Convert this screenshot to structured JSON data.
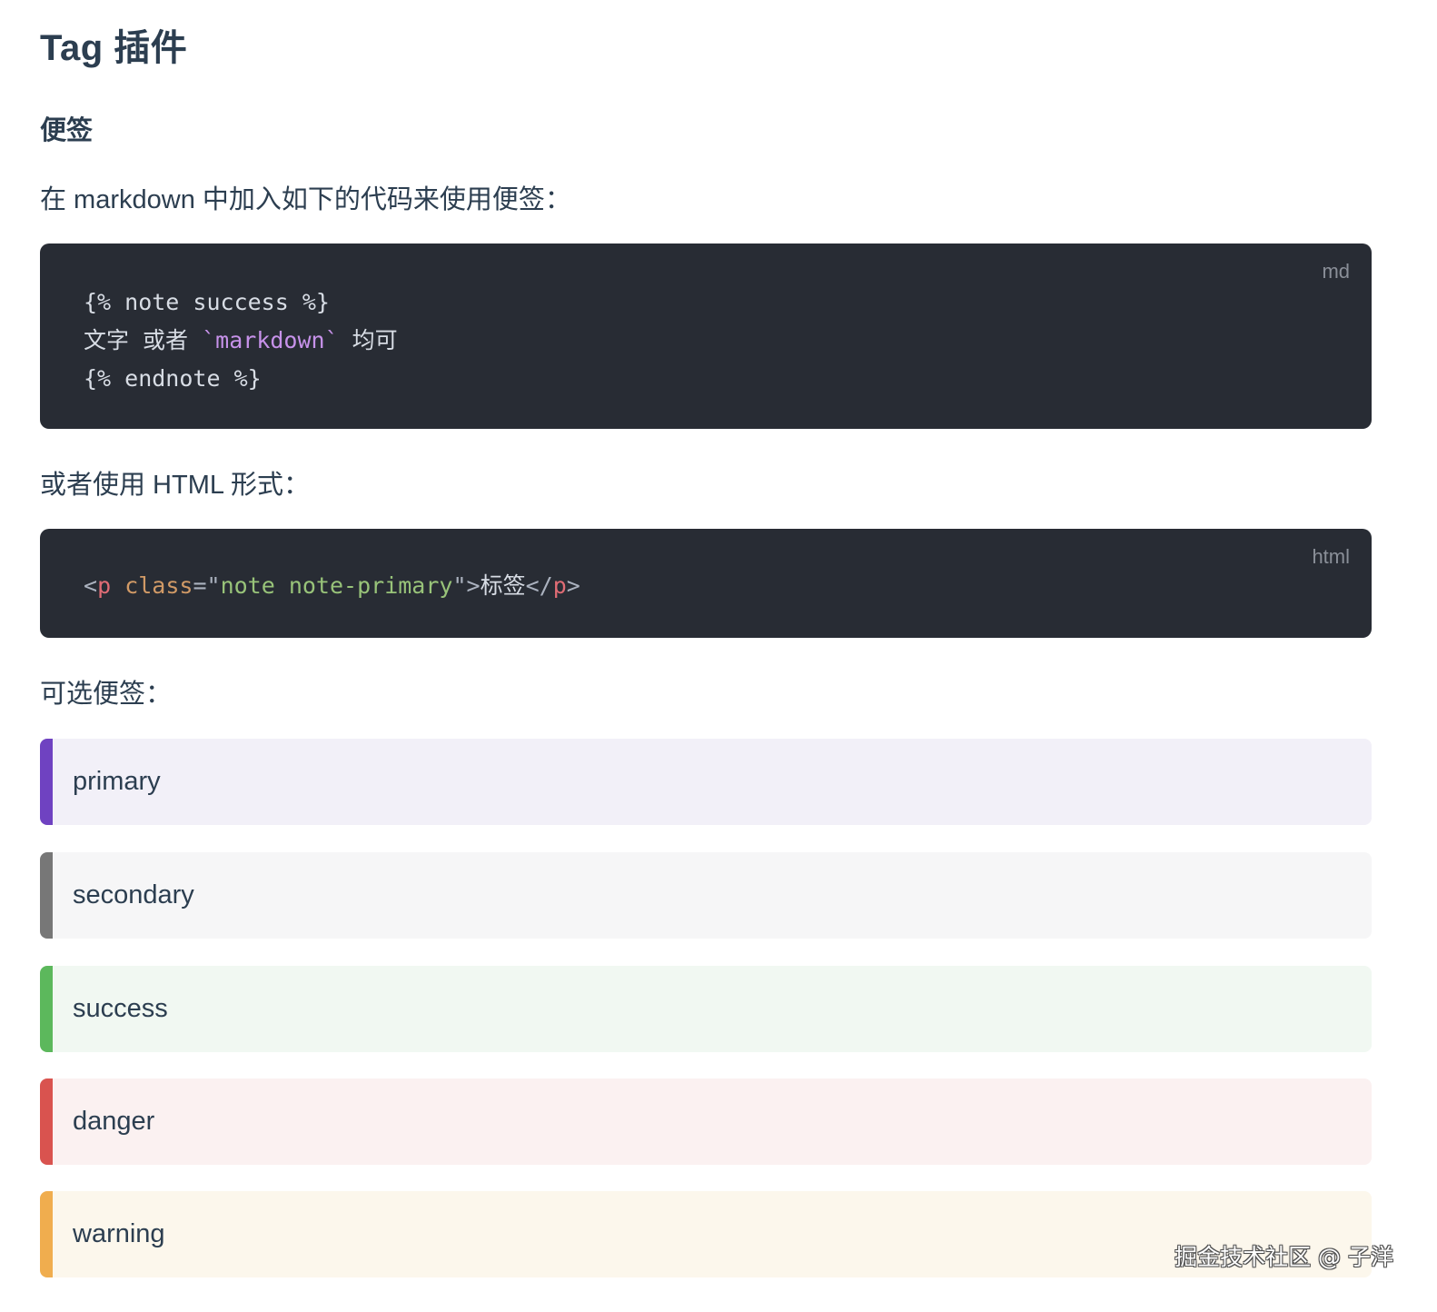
{
  "title": "Tag 插件",
  "section": "便签",
  "intro_md": "在 markdown 中加入如下的代码来使用便签：",
  "code_md": {
    "lang": "md",
    "line1": "{% note success %}",
    "line2_prefix": "文字 或者 ",
    "line2_code": "`markdown`",
    "line2_suffix": " 均可",
    "line3": "{% endnote %}"
  },
  "intro_html": "或者使用 HTML 形式：",
  "code_html": {
    "lang": "html",
    "open_lt": "<",
    "tag": "p",
    "space": " ",
    "attr": "class",
    "eq": "=",
    "quote_open": "\"",
    "value": "note note-primary",
    "quote_close": "\"",
    "gt": ">",
    "text": "标签",
    "close_lt": "</",
    "close_tag": "p",
    "close_gt": ">"
  },
  "options_label": "可选便签：",
  "notes": [
    {
      "label": "primary",
      "border": "#6f42c1",
      "bg": "#f2f0f8"
    },
    {
      "label": "secondary",
      "border": "#777777",
      "bg": "#f6f6f7"
    },
    {
      "label": "success",
      "border": "#5cb85c",
      "bg": "#f1f8f2"
    },
    {
      "label": "danger",
      "border": "#d9534f",
      "bg": "#fbf1f1"
    },
    {
      "label": "warning",
      "border": "#f0ad4e",
      "bg": "#fcf7ec"
    }
  ],
  "watermark": "掘金技术社区 @ 子洋"
}
